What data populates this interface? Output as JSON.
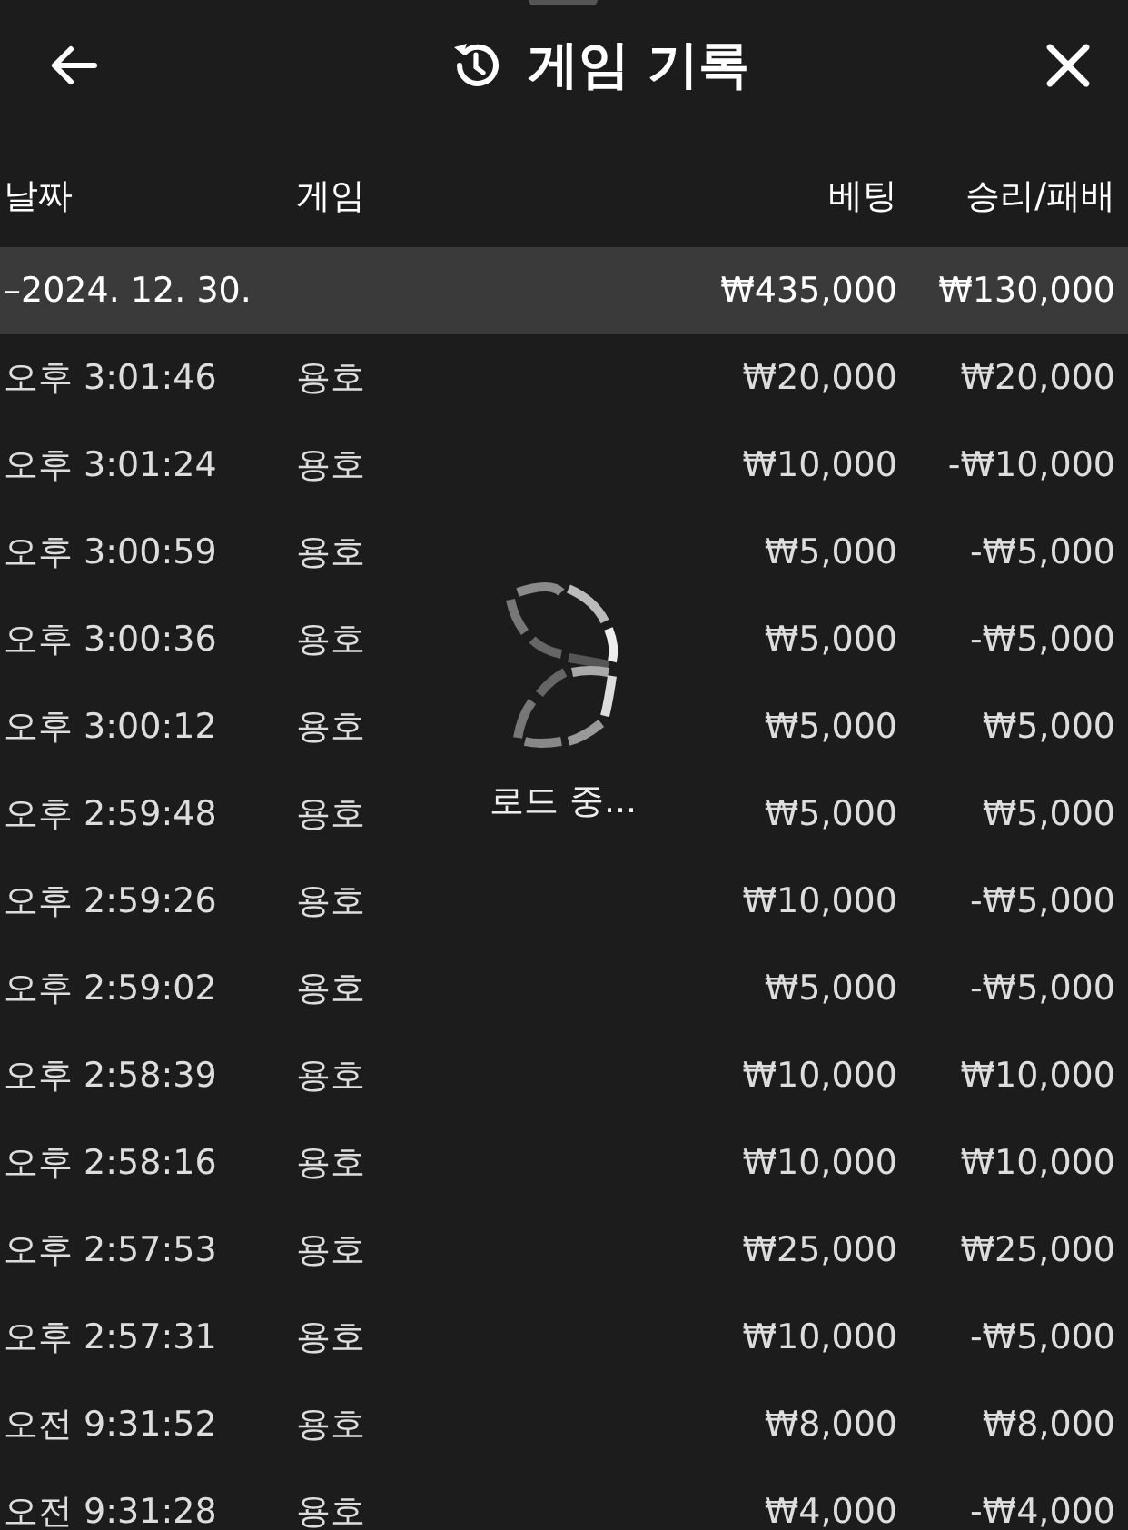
{
  "header": {
    "title": "게임 기록"
  },
  "table": {
    "columns": [
      "날짜",
      "게임",
      "베팅",
      "승리/패배"
    ],
    "summary": {
      "date": "–2024. 12. 30.",
      "bet": "₩435,000",
      "result": "₩130,000"
    },
    "rows": [
      {
        "time": "오후 3:01:46",
        "game": "용호",
        "bet": "₩20,000",
        "result": "₩20,000"
      },
      {
        "time": "오후 3:01:24",
        "game": "용호",
        "bet": "₩10,000",
        "result": "-₩10,000"
      },
      {
        "time": "오후 3:00:59",
        "game": "용호",
        "bet": "₩5,000",
        "result": "-₩5,000"
      },
      {
        "time": "오후 3:00:36",
        "game": "용호",
        "bet": "₩5,000",
        "result": "-₩5,000"
      },
      {
        "time": "오후 3:00:12",
        "game": "용호",
        "bet": "₩5,000",
        "result": "₩5,000"
      },
      {
        "time": "오후 2:59:48",
        "game": "용호",
        "bet": "₩5,000",
        "result": "₩5,000"
      },
      {
        "time": "오후 2:59:26",
        "game": "용호",
        "bet": "₩10,000",
        "result": "-₩5,000"
      },
      {
        "time": "오후 2:59:02",
        "game": "용호",
        "bet": "₩5,000",
        "result": "-₩5,000"
      },
      {
        "time": "오후 2:58:39",
        "game": "용호",
        "bet": "₩10,000",
        "result": "₩10,000"
      },
      {
        "time": "오후 2:58:16",
        "game": "용호",
        "bet": "₩10,000",
        "result": "₩10,000"
      },
      {
        "time": "오후 2:57:53",
        "game": "용호",
        "bet": "₩25,000",
        "result": "₩25,000"
      },
      {
        "time": "오후 2:57:31",
        "game": "용호",
        "bet": "₩10,000",
        "result": "-₩5,000"
      },
      {
        "time": "오전 9:31:52",
        "game": "용호",
        "bet": "₩8,000",
        "result": "₩8,000"
      },
      {
        "time": "오전 9:31:28",
        "game": "용호",
        "bet": "₩4,000",
        "result": "-₩4,000"
      }
    ]
  },
  "loading": {
    "label": "로드 중..."
  }
}
